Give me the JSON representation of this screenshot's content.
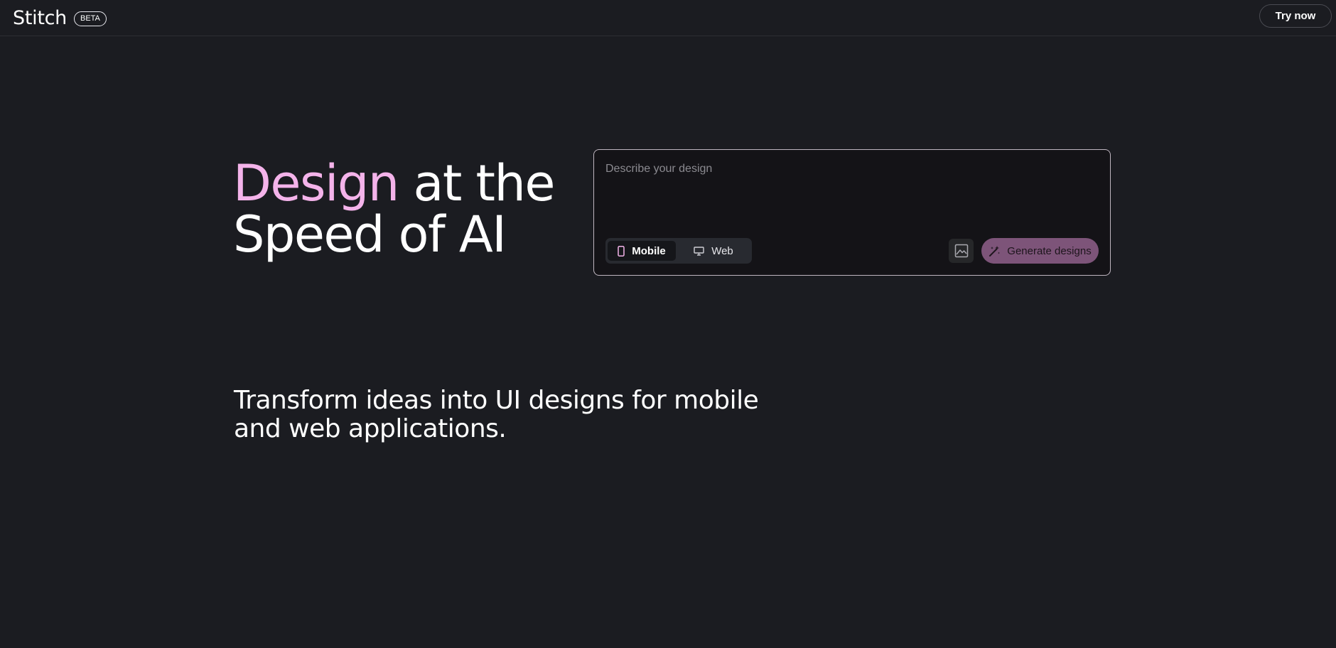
{
  "header": {
    "brand": "Stitch",
    "badge": "BETA",
    "cta_label": "Try now"
  },
  "hero": {
    "title_accent": "Design",
    "title_line1_rest": " at the",
    "title_line2": "Speed of AI",
    "subtitle": "Transform ideas into UI designs for mobile and web applications."
  },
  "prompt": {
    "placeholder": "Describe your design",
    "value": "",
    "device_options": [
      {
        "label": "Mobile",
        "icon": "smartphone-icon",
        "selected": true
      },
      {
        "label": "Web",
        "icon": "monitor-icon",
        "selected": false
      }
    ],
    "image_button_icon": "image-icon",
    "generate_label": "Generate designs",
    "generate_icon": "magic-wand-icon"
  },
  "colors": {
    "background": "#1b1c21",
    "accent_text": "#f4b3ea",
    "generate_button": "#7d5479",
    "card_border": "#bfb6c0"
  }
}
